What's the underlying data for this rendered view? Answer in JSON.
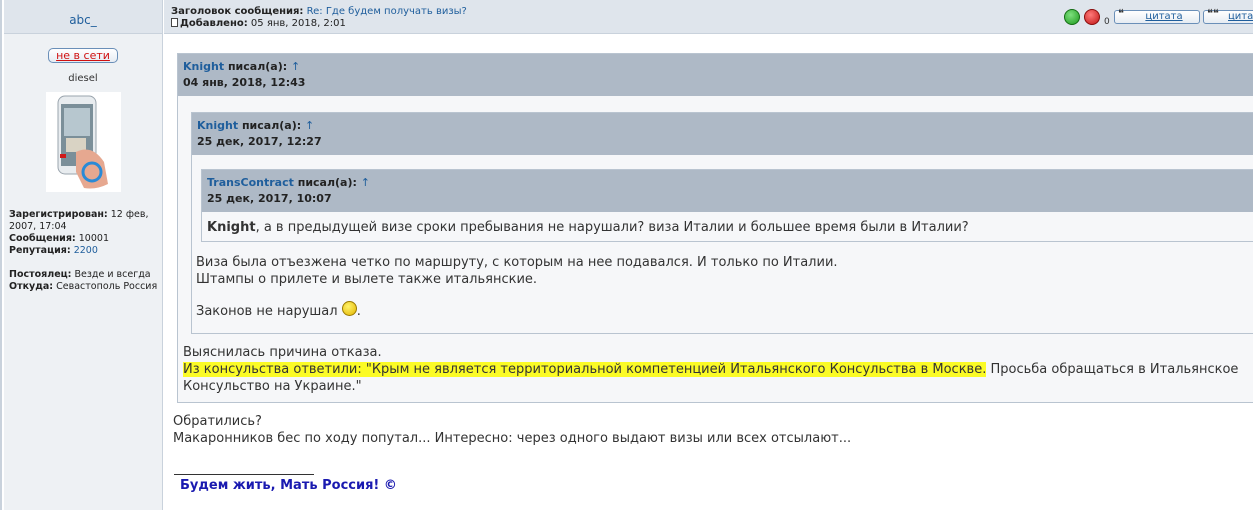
{
  "author": {
    "username": "abc_",
    "status_label": "не в сети",
    "rank": "diesel",
    "registered_label": "Зарегистрирован:",
    "registered_value": "12 фев, 2007, 17:04",
    "messages_label": "Сообщения:",
    "messages_value": "10001",
    "reputation_label": "Репутация:",
    "reputation_value": "2200",
    "resident_label": "Постоялец:",
    "resident_value": "Везде и всегда",
    "from_label": "Откуда:",
    "from_value": "Севастополь Россия"
  },
  "post": {
    "subject_label": "Заголовок сообщения:",
    "subject_value": "Re: Где будем получать визы?",
    "added_label": "Добавлено:",
    "added_value": "05 янв, 2018, 2:01",
    "rep_count": "0",
    "quote_label": "цитата",
    "multiquote_label": "цитата"
  },
  "quotes": {
    "wrote": "писал(а):",
    "arrow": "↑",
    "q1": {
      "author": "Knight",
      "date": "04 янв, 2018, 12:43",
      "text1": "Выяснилась причина отказа.",
      "text2_highlight": "Из консульства ответили: \"Крым не является территориальной компетенцией Итальянского Консульства в Москве.",
      "text2_rest": " Просьба обращаться в Итальянское",
      "text3": "Консульство на Украине.\""
    },
    "q2": {
      "author": "Knight",
      "date": "25 дек, 2017, 12:27",
      "text1": "Виза была отъезжена четко по маршруту, с которым на нее подавался. И только по Италии.",
      "text2": "Штампы о прилете и вылете также итальянские.",
      "text3": "Законов не нарушал",
      "text3_end": "."
    },
    "q3": {
      "author": "TransContract",
      "date": "25 дек, 2017, 10:07",
      "bold_name": "Knight",
      "text": ", а в предыдущей визе сроки пребывания не нарушали? виза Италии и большее время были в Италии?"
    }
  },
  "body": {
    "line1": "Обратились?",
    "line2": "Макаронников бес по ходу попутал... Интересно: через одного выдают визы или всех отсылают...",
    "signature": "Будем жить, Мать Россия! ©"
  }
}
